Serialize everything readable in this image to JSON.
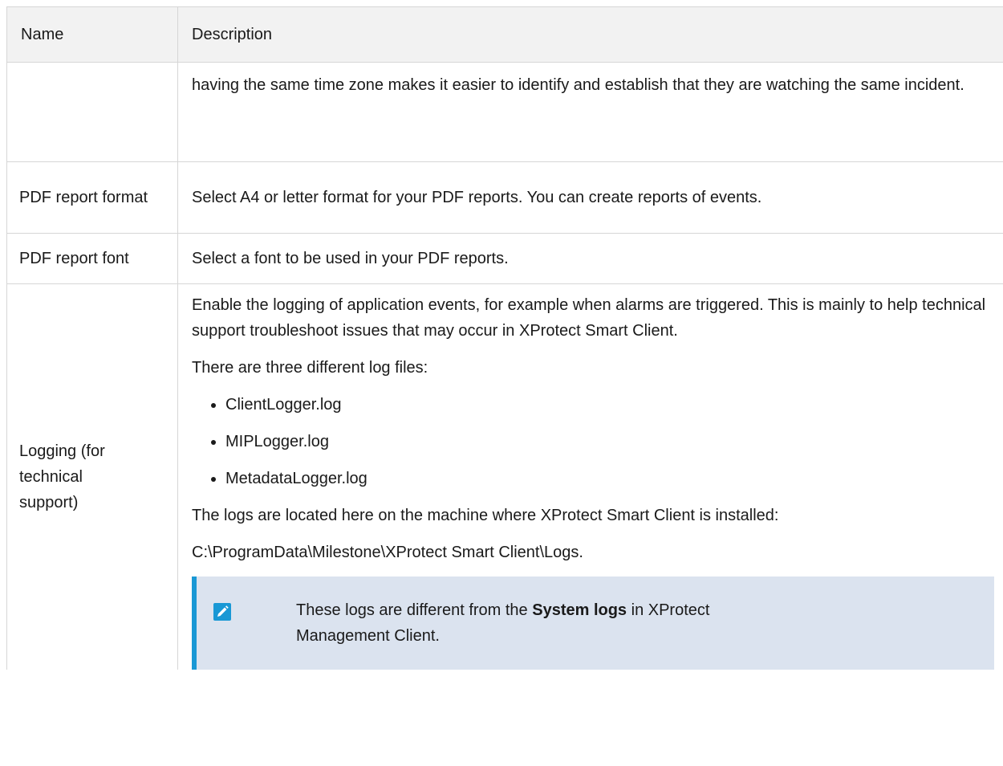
{
  "table": {
    "headers": {
      "name": "Name",
      "description": "Description"
    },
    "rows": {
      "continued": {
        "name": "",
        "description": "having the same time zone makes it easier to identify and establish that they are watching the same incident."
      },
      "pdf_format": {
        "name": "PDF report format",
        "description": "Select A4 or letter format for your PDF reports. You can create reports of events."
      },
      "pdf_font": {
        "name": "PDF report font",
        "description": "Select a font to be used in your PDF reports."
      },
      "logging": {
        "name": "Logging (for technical support)",
        "paragraph1": "Enable the logging of application events, for example when alarms are triggered. This is mainly to help technical support troubleshoot issues that may occur in XProtect Smart Client.",
        "paragraph2": "There are three different log files:",
        "log_files": [
          "ClientLogger.log",
          "MIPLogger.log",
          "MetadataLogger.log"
        ],
        "paragraph3": "The logs are located here on the machine where XProtect Smart Client is installed:",
        "path": "C:\\ProgramData\\Milestone\\XProtect Smart Client\\Logs.",
        "note": {
          "prefix": "These logs are different from the ",
          "bold": "System logs",
          "suffix_line1": " in XProtect",
          "line2": "Management Client."
        }
      }
    }
  },
  "colors": {
    "note_background": "#dbe3ef",
    "note_accent": "#1998d5",
    "header_background": "#f2f2f2"
  },
  "icons": {
    "note": "pencil-icon"
  }
}
